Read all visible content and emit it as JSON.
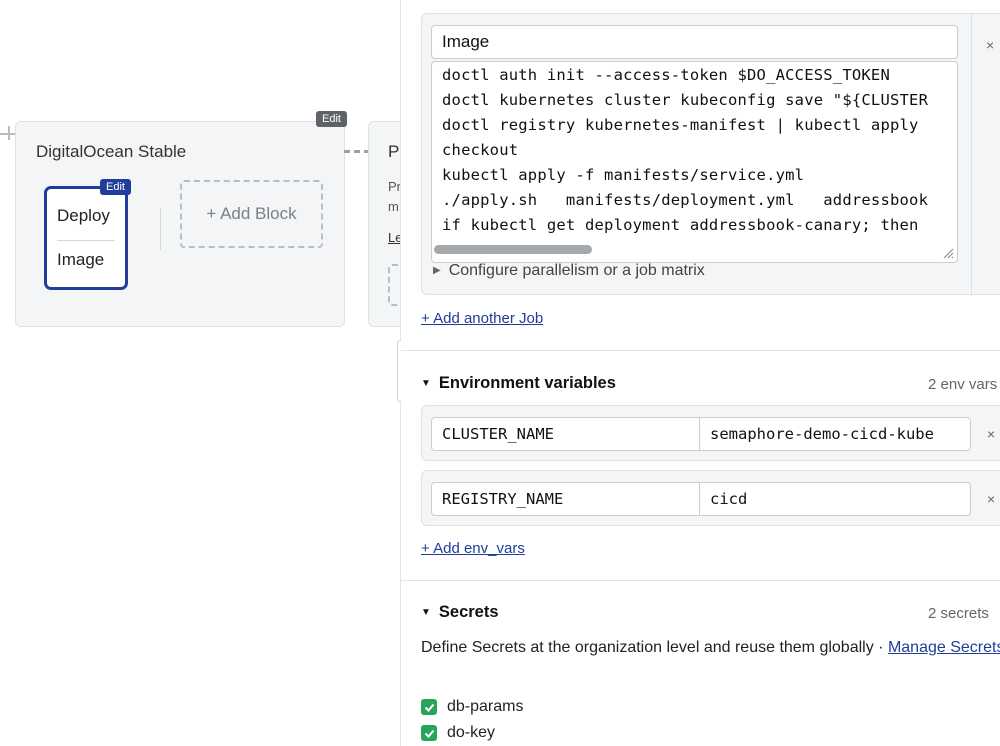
{
  "canvas": {
    "stage1": {
      "title": "DigitalOcean Stable",
      "edit_label": "Edit",
      "block": {
        "edit_label": "Edit",
        "line1": "Deploy",
        "line2": "Image"
      },
      "add_block_label": "+ Add Block"
    },
    "stage2": {
      "title": "P",
      "desc_line1": "Pr",
      "desc_line2": "m",
      "link": "Le"
    }
  },
  "job": {
    "name": "Image",
    "commands": [
      "doctl auth init --access-token $DO_ACCESS_TOKEN",
      "doctl kubernetes cluster kubeconfig save \"${CLUSTER",
      "doctl registry kubernetes-manifest | kubectl apply",
      "checkout",
      "kubectl apply -f manifests/service.yml",
      "./apply.sh   manifests/deployment.yml   addressbook",
      "if kubectl get deployment addressbook-canary; then"
    ],
    "parallelism_label": "Configure parallelism or a job matrix",
    "close_icon": "×"
  },
  "add_job_label": "+ Add another Job",
  "env": {
    "title": "Environment variables",
    "count": "2 env vars",
    "vars": [
      {
        "name": "CLUSTER_NAME",
        "value": "semaphore-demo-cicd-kube"
      },
      {
        "name": "REGISTRY_NAME",
        "value": "cicd"
      }
    ],
    "add_label": "+ Add env_vars",
    "close_icon": "×"
  },
  "secrets": {
    "title": "Secrets",
    "count": "2 secrets",
    "description": "Define Secrets at the organization level and reuse them globally · ",
    "manage_label": "Manage Secrets",
    "items": [
      "db-params",
      "do-key"
    ],
    "check_color": "#27a35a"
  },
  "colors": {
    "accent": "#1f3d99",
    "card_bg": "#f3f5f6"
  }
}
